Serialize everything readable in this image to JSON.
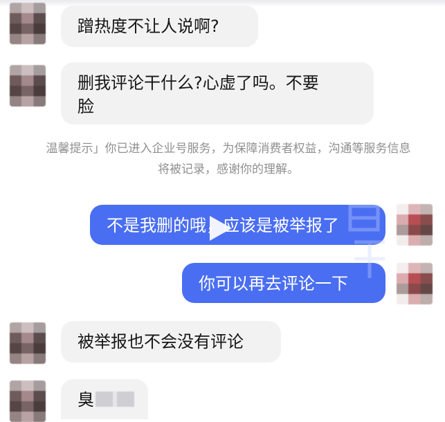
{
  "messages": [
    {
      "side": "incoming",
      "text": "蹭热度不让人说啊?"
    },
    {
      "side": "incoming",
      "text": "删我评论干什么?心虚了吗。不要\n脸"
    },
    {
      "side": "outgoing",
      "text": "不是我删的哦，应该是被举报了"
    },
    {
      "side": "outgoing",
      "text": "你可以再去评论一下"
    },
    {
      "side": "incoming",
      "text": "被举报也不会没有评论"
    },
    {
      "side": "incoming",
      "text": "臭"
    }
  ],
  "system_notice": "温馨提示」你已进入企业号服务，为保障消费者权益，沟通等服务信息将被记录，感谢你的理解。",
  "colors": {
    "outgoing_bubble": "#4a6ef2",
    "incoming_bubble": "#f2f2f2",
    "notice_text": "#8f8f8f"
  },
  "icons": [
    "play-icon"
  ]
}
